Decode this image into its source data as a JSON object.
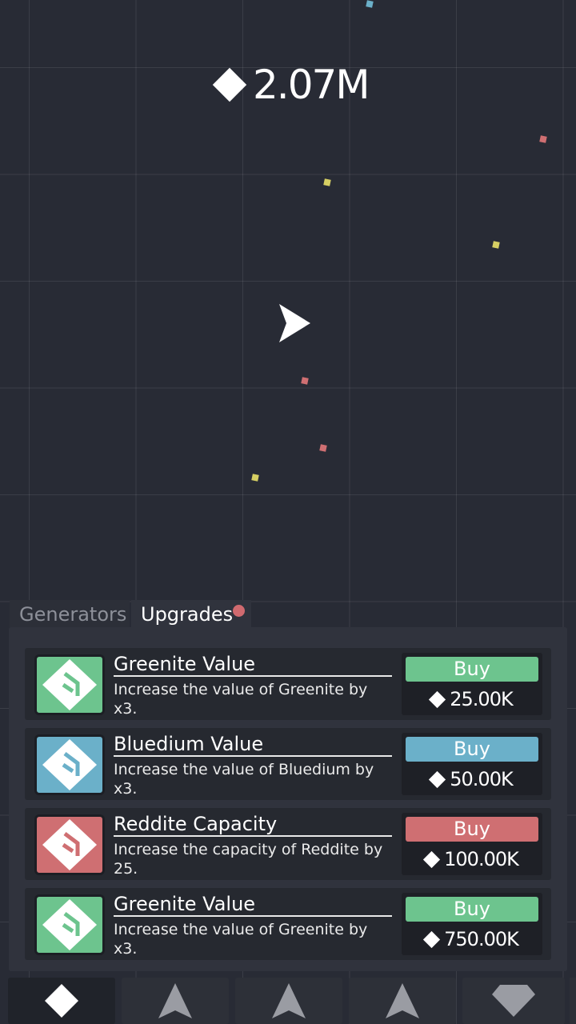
{
  "hud": {
    "currency_icon": "diamond-icon",
    "currency_value": "2.07M"
  },
  "tabs": [
    {
      "label": "Generators",
      "active": false
    },
    {
      "label": "Upgrades",
      "active": true,
      "has_notification": true
    }
  ],
  "upgrades": [
    {
      "icon": "upgrade-chevron-icon",
      "color": "#6dc48e",
      "title": "Greenite Value",
      "description": "Increase the value of Greenite by x3.",
      "buy_label": "Buy",
      "price": "25.00K"
    },
    {
      "icon": "upgrade-chevron-icon",
      "color": "#6bb0c9",
      "title": "Bluedium Value",
      "description": "Increase the value of Bluedium by x3.",
      "buy_label": "Buy",
      "price": "50.00K"
    },
    {
      "icon": "upgrade-chevron-icon",
      "color": "#cf6f72",
      "title": "Reddite Capacity",
      "description": "Increase the capacity of Reddite by 25.",
      "buy_label": "Buy",
      "price": "100.00K"
    },
    {
      "icon": "upgrade-chevron-icon",
      "color": "#6dc48e",
      "title": "Greenite Value",
      "description": "Increase the value of Greenite by x3.",
      "buy_label": "Buy",
      "price": "750.00K"
    }
  ],
  "nav": [
    {
      "icon": "diamond-icon",
      "active": true
    },
    {
      "icon": "ship-icon",
      "active": false
    },
    {
      "icon": "ship-icon",
      "active": false
    },
    {
      "icon": "ship-icon",
      "active": false
    },
    {
      "icon": "gem-icon",
      "active": false
    }
  ],
  "colors": {
    "background": "#282b35",
    "green": "#6dc48e",
    "blue": "#6bb0c9",
    "red": "#cf6f72",
    "yellow": "#d6cf63",
    "notification": "#d06a6f"
  }
}
